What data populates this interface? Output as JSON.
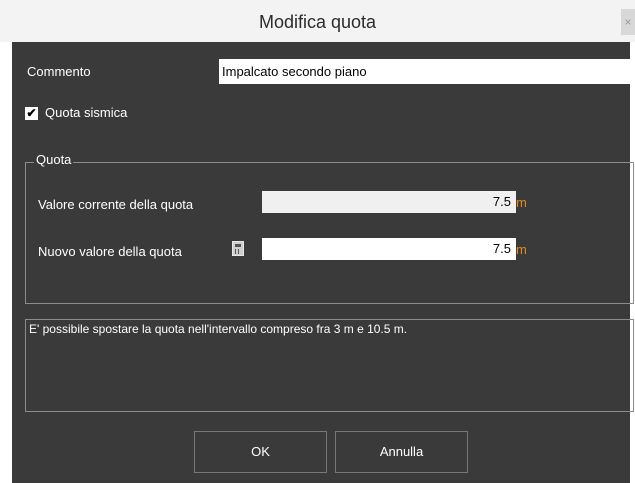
{
  "window": {
    "title": "Modifica quota",
    "close_label": "×"
  },
  "form": {
    "commento_label": "Commento",
    "commento_value": "Impalcato secondo piano",
    "checkbox_label": "Quota sismica",
    "checkbox_checked": true,
    "checkbox_mark": "✔"
  },
  "group": {
    "title": "Quota",
    "current_label": "Valore corrente della quota",
    "current_value": "7.5",
    "current_unit": "m",
    "new_label": "Nuovo valore della quota",
    "new_value": "7.5",
    "new_unit": "m"
  },
  "message": "E' possibile spostare la quota nell'intervallo compreso fra  3 m e  10.5 m.",
  "buttons": {
    "ok": "OK",
    "cancel": "Annulla"
  },
  "colors": {
    "background": "#3a3a3a",
    "unit": "#e58a1a",
    "titlebar": "#f3f3f3"
  }
}
